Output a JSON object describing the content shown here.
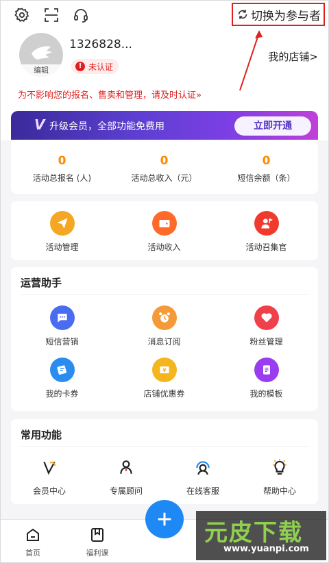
{
  "header": {
    "switch_label": "切换为参与者"
  },
  "profile": {
    "phone": "1326828...",
    "avatar_edit": "编辑",
    "status_badge": "未认证",
    "my_store": "我的店铺>",
    "notice": "为不影响您的报名、售卖和管理，请及时认证»"
  },
  "vip": {
    "logo": "V",
    "text": "升级会员，全部功能免费用",
    "button": "立即开通"
  },
  "stats": [
    {
      "value": "0",
      "label": "活动总报名 (人)"
    },
    {
      "value": "0",
      "label": "活动总收入（元）"
    },
    {
      "value": "0",
      "label": "短信余额（条）"
    }
  ],
  "activity": [
    {
      "label": "活动管理",
      "icon": "paper-plane-icon",
      "color": "#f5a623"
    },
    {
      "label": "活动收入",
      "icon": "wallet-icon",
      "color": "#ff6a2a"
    },
    {
      "label": "活动召集官",
      "icon": "person-flag-icon",
      "color": "#f03a2e"
    }
  ],
  "ops": {
    "title": "运营助手",
    "items": [
      {
        "label": "短信营销",
        "icon": "chat-bubble-icon",
        "color": "#4a6cf0"
      },
      {
        "label": "消息订阅",
        "icon": "alarm-clock-icon",
        "color": "#f59a38"
      },
      {
        "label": "粉丝管理",
        "icon": "heart-icon",
        "color": "#f0404a"
      },
      {
        "label": "我的卡券",
        "icon": "ticket-icon",
        "color": "#2a8cf0"
      },
      {
        "label": "店铺优惠券",
        "icon": "coupon-icon",
        "color": "#f5b51e"
      },
      {
        "label": "我的模板",
        "icon": "template-icon",
        "color": "#9a3df0"
      }
    ]
  },
  "common": {
    "title": "常用功能",
    "items": [
      {
        "label": "会员中心",
        "icon": "vip-icon"
      },
      {
        "label": "专属顾问",
        "icon": "person-icon"
      },
      {
        "label": "在线客服",
        "icon": "headset-icon"
      },
      {
        "label": "帮助中心",
        "icon": "lightbulb-icon"
      }
    ]
  },
  "nav": [
    {
      "label": "首页",
      "icon": "home-icon"
    },
    {
      "label": "福利课",
      "icon": "bookmark-icon"
    }
  ],
  "watermark": {
    "brand": "元皮下载",
    "url": "www.yuanpi.com"
  }
}
